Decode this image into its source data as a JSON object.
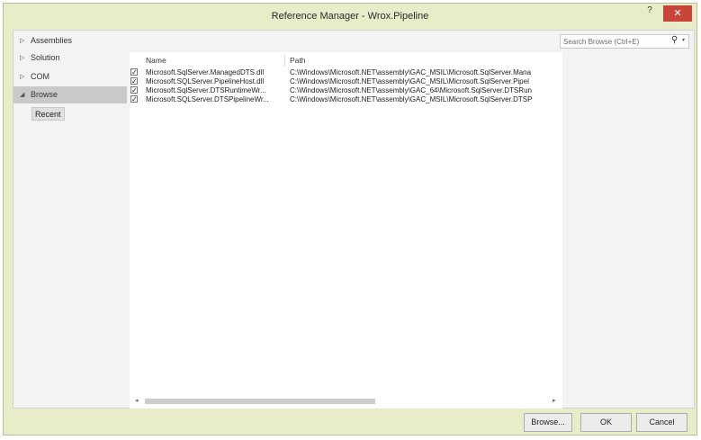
{
  "window": {
    "title": "Reference Manager - Wrox.Pipeline",
    "help_label": "?",
    "close_label": "✕"
  },
  "sidebar": {
    "items": [
      {
        "label": "Assemblies",
        "expanded": false
      },
      {
        "label": "Solution",
        "expanded": false
      },
      {
        "label": "COM",
        "expanded": false
      },
      {
        "label": "Browse",
        "expanded": true,
        "selected": true
      }
    ],
    "recent_label": "Recent"
  },
  "search": {
    "placeholder": "Search Browse (Ctrl+E)"
  },
  "table": {
    "columns": [
      "Name",
      "Path"
    ],
    "rows": [
      {
        "checked": true,
        "name": "Microsoft.SqlServer.ManagedDTS.dll",
        "path": "C:\\Windows\\Microsoft.NET\\assembly\\GAC_MSIL\\Microsoft.SqlServer.Mana"
      },
      {
        "checked": true,
        "name": "Microsoft.SQLServer.PipelineHost.dll",
        "path": "C:\\Windows\\Microsoft.NET\\assembly\\GAC_MSIL\\Microsoft.SqlServer.Pipel"
      },
      {
        "checked": true,
        "name": "Microsoft.SqlServer.DTSRuntimeWr...",
        "path": "C:\\Windows\\Microsoft.NET\\assembly\\GAC_64\\Microsoft.SqlServer.DTSRun"
      },
      {
        "checked": true,
        "name": "Microsoft.SQLServer.DTSPipelineWr...",
        "path": "C:\\Windows\\Microsoft.NET\\assembly\\GAC_MSIL\\Microsoft.SqlServer.DTSP"
      }
    ]
  },
  "buttons": {
    "browse": "Browse...",
    "ok": "OK",
    "cancel": "Cancel"
  },
  "icons": {
    "collapsed_arrow": "▷",
    "expanded_arrow": "◢",
    "check": "✓",
    "search": "⚲",
    "dropdown": "▾",
    "scroll_left": "◂",
    "scroll_right": "▸"
  }
}
